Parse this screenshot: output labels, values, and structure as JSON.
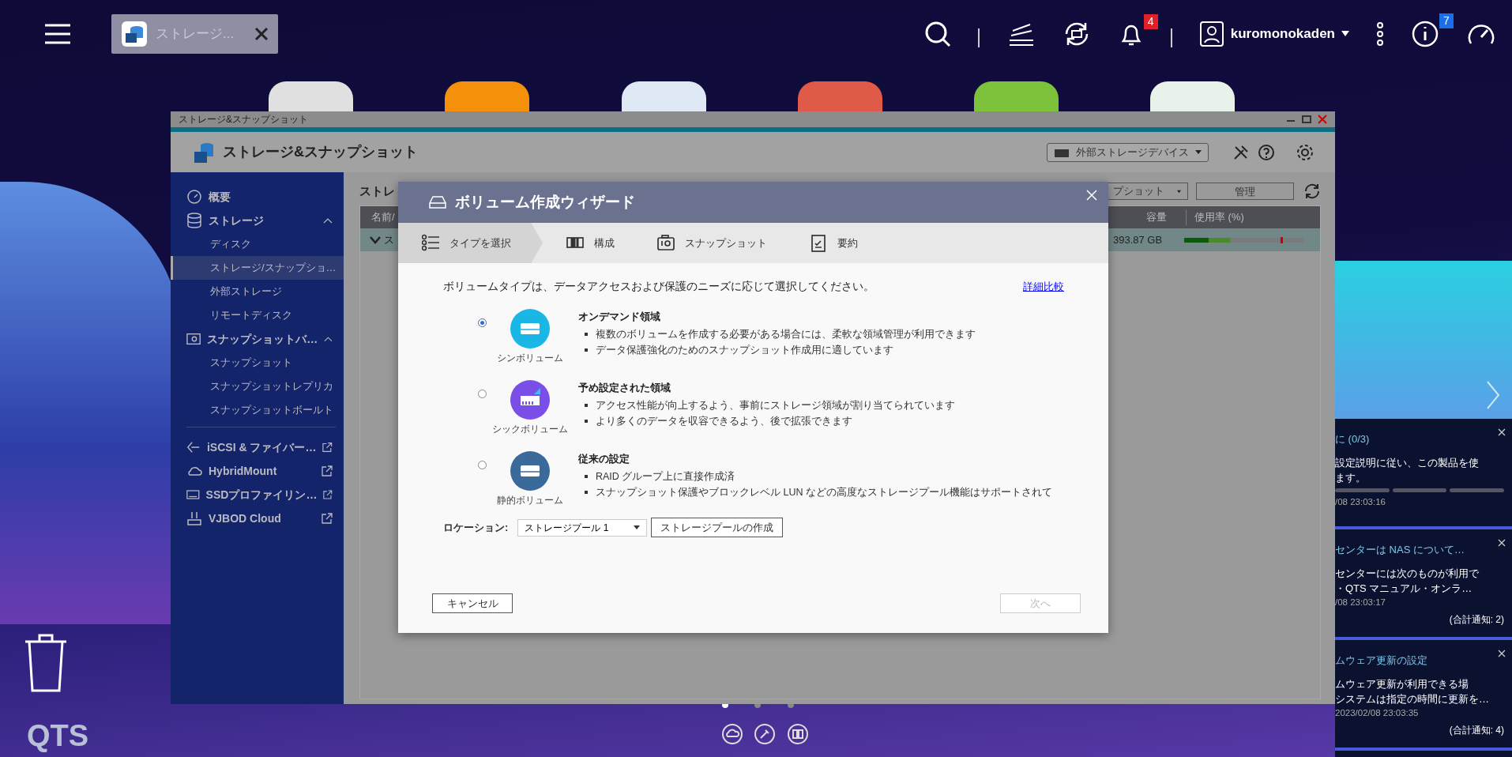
{
  "topbar": {
    "task_tab": {
      "label": "ストレージ..."
    },
    "notification_count": "4",
    "user": "kuromonokaden",
    "info_count": "7"
  },
  "desktop": {
    "label": "QTS"
  },
  "window": {
    "title": "ストレージ&スナップショット",
    "app_title": "ストレージ&スナップショット",
    "device_dropdown": "外部ストレージデバイス",
    "sidebar": [
      {
        "kind": "section",
        "label": "概要"
      },
      {
        "kind": "section",
        "label": "ストレージ",
        "expanded": true,
        "children": [
          {
            "label": "ディスク",
            "selected": false
          },
          {
            "label": "ストレージ/スナップショ…",
            "selected": true
          },
          {
            "label": "外部ストレージ",
            "selected": false
          },
          {
            "label": "リモートディスク",
            "selected": false
          }
        ]
      },
      {
        "kind": "section",
        "label": "スナップショットバ…",
        "expanded": true,
        "children": [
          {
            "label": "スナップショット",
            "selected": false
          },
          {
            "label": "スナップショットレプリカ",
            "selected": false
          },
          {
            "label": "スナップショットボールト",
            "selected": false
          }
        ]
      },
      {
        "kind": "link",
        "label": "iSCSI & ファイバー…"
      },
      {
        "kind": "link",
        "label": "HybridMount"
      },
      {
        "kind": "link",
        "label": "SSDプロファイリン…"
      },
      {
        "kind": "link",
        "label": "VJBOD Cloud"
      }
    ],
    "content": {
      "title": "ストレ",
      "dropdown": "プショット",
      "manage_button": "管理",
      "columns": [
        "名前/",
        "容量",
        "使用率 (%)"
      ],
      "row": {
        "name": "ス",
        "expanded": true,
        "capacity": "393.87 GB",
        "usage": {
          "level": 0.38
        },
        "threshold": {
          "level": 0.8
        }
      }
    }
  },
  "dialog": {
    "title": "ボリューム作成ウィザード",
    "steps": [
      {
        "label": "タイプを選択",
        "selected": true
      },
      {
        "label": "構成",
        "selected": false
      },
      {
        "label": "スナップショット",
        "selected": false
      },
      {
        "label": "要約",
        "selected": false
      }
    ],
    "intro": "ボリュームタイプは、データアクセスおよび保護のニーズに応じて選択してください。",
    "compare_link": "詳細比較",
    "options": [
      {
        "kind": "thin",
        "caption": "シンボリューム",
        "heading": "オンデマンド領域",
        "selected": true,
        "color": "#1ab6e6",
        "bullets": [
          "複数のボリュームを作成する必要がある場合には、柔軟な領域管理が利用できます",
          "データ保護強化のためのスナップショット作成用に適しています"
        ]
      },
      {
        "kind": "thick",
        "caption": "シックボリューム",
        "heading": "予め設定された領域",
        "selected": false,
        "color": "#7a4fe8",
        "bullets": [
          "アクセス性能が向上するよう、事前にストレージ領域が割り当てられています",
          "より多くのデータを収容できるよう、後で拡張できます"
        ]
      },
      {
        "kind": "static",
        "caption": "静的ボリューム",
        "heading": "従来の設定",
        "selected": false,
        "color": "#3a6a9a",
        "bullets": [
          "RAID グループ上に直接作成済",
          "スナップショット保護やブロックレベル LUN などの高度なストレージプール機能はサポートされて"
        ]
      }
    ],
    "location": {
      "label": "ロケーション:",
      "value": "ストレージプール 1"
    },
    "create_pool_button": "ストレージプールの作成",
    "cancel_button": "キャンセル",
    "next_button": {
      "label": "次へ",
      "disabled": true
    }
  },
  "notifications": [
    {
      "title": "に (0/3)",
      "lines": [
        "設定説明に従い、この製品を使",
        "ます。"
      ],
      "progress": true,
      "time": "/08 23:03:16"
    },
    {
      "title": "センターは NAS について…",
      "lines": [
        "センターには次のものが利用で",
        "・QTS マニュアル・オンラ…"
      ],
      "progress": false,
      "time": "/08 23:03:17",
      "total": "(合計通知: 2)"
    },
    {
      "title": "ムウェア更新の設定",
      "lines": [
        "ムウェア更新が利用できる場",
        "システムは指定の時間に更新を…"
      ],
      "progress": false,
      "time": "2023/02/08 23:03:35",
      "total": "(合計通知: 4)"
    }
  ]
}
